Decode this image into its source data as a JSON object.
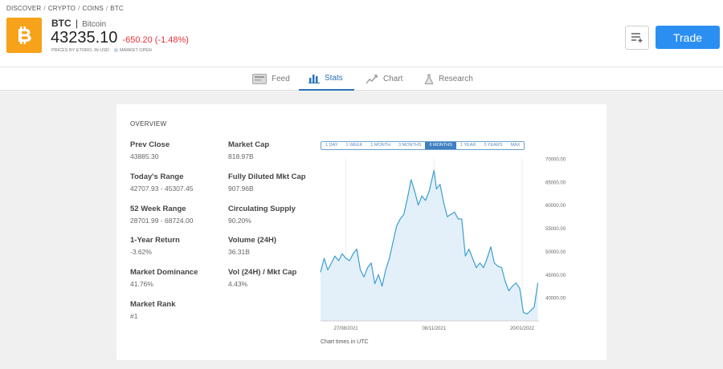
{
  "breadcrumb": [
    "DISCOVER",
    "CRYPTO",
    "COINS",
    "BTC"
  ],
  "asset": {
    "ticker": "BTC",
    "name": "Bitcoin",
    "price": "43235.10",
    "change": "-650.20 (-1.48%)",
    "price_source": "PRICES BY ETORO, IN USD",
    "market_status": "MARKET OPEN",
    "logo_icon": "bitcoin-logo-icon",
    "logo_color": "#f7a21a"
  },
  "actions": {
    "list_icon": "add-to-list-icon",
    "trade_label": "Trade",
    "trade_color": "#2b8ff2"
  },
  "tabs": [
    {
      "label": "Feed",
      "icon": "feed-icon"
    },
    {
      "label": "Stats",
      "icon": "stats-icon",
      "active": true
    },
    {
      "label": "Chart",
      "icon": "chart-icon"
    },
    {
      "label": "Research",
      "icon": "research-icon"
    }
  ],
  "overview": {
    "title": "OVERVIEW",
    "left": [
      {
        "label": "Prev Close",
        "value": "43885.30"
      },
      {
        "label": "Today's Range",
        "value": "42707.93 - 45307.45"
      },
      {
        "label": "52 Week Range",
        "value": "28701.99 - 68724.00"
      },
      {
        "label": "1-Year Return",
        "value": "-3.62%"
      },
      {
        "label": "Market Dominance",
        "value": "41.76%"
      },
      {
        "label": "Market Rank",
        "value": "#1"
      }
    ],
    "right": [
      {
        "label": "Market Cap",
        "value": "818.97B"
      },
      {
        "label": "Fully Diluted Mkt Cap",
        "value": "907.96B"
      },
      {
        "label": "Circulating Supply",
        "value": "90.20%"
      },
      {
        "label": "Volume (24H)",
        "value": "36.31B"
      },
      {
        "label": "Vol (24H) / Mkt Cap",
        "value": "4.43%"
      }
    ]
  },
  "range_tabs": [
    {
      "label": "1 DAY"
    },
    {
      "label": "1 WEEK"
    },
    {
      "label": "1 MONTH"
    },
    {
      "label": "3 MONTHS"
    },
    {
      "label": "6 MONTHS",
      "active": true
    },
    {
      "label": "1 YEAR"
    },
    {
      "label": "3 YEARS"
    },
    {
      "label": "MAX"
    }
  ],
  "chart_data": {
    "type": "area",
    "line_color": "#3a9fd1",
    "fill_color": "#e3f0fa",
    "ylim": [
      35000,
      70000
    ],
    "y_ticks": [
      "70000.00",
      "65000.00",
      "60000.00",
      "55000.00",
      "50000.00",
      "45000.00",
      "40000.00"
    ],
    "y_tick_values": [
      70000,
      65000,
      60000,
      55000,
      50000,
      45000,
      40000
    ],
    "x_ticks": [
      "27/08/2021",
      "08/11/2021",
      "20/01/2022"
    ],
    "x_tick_dates": [
      "2021-08-27",
      "2021-11-08",
      "2022-01-20"
    ],
    "x_range": [
      "2021-08-06",
      "2022-02-03"
    ],
    "series": [
      {
        "x": [
          "2021-08-06",
          "2021-08-09",
          "2021-08-12",
          "2021-08-15",
          "2021-08-18",
          "2021-08-21",
          "2021-08-24",
          "2021-08-27",
          "2021-08-30",
          "2021-09-02",
          "2021-09-05",
          "2021-09-08",
          "2021-09-11",
          "2021-09-14",
          "2021-09-17",
          "2021-09-20",
          "2021-09-23",
          "2021-09-26",
          "2021-09-29",
          "2021-10-02",
          "2021-10-05",
          "2021-10-08",
          "2021-10-11",
          "2021-10-14",
          "2021-10-17",
          "2021-10-20",
          "2021-10-23",
          "2021-10-26",
          "2021-10-29",
          "2021-11-01",
          "2021-11-04",
          "2021-11-08",
          "2021-11-10",
          "2021-11-13",
          "2021-11-16",
          "2021-11-19",
          "2021-11-22",
          "2021-11-25",
          "2021-11-28",
          "2021-12-01",
          "2021-12-04",
          "2021-12-07",
          "2021-12-10",
          "2021-12-13",
          "2021-12-16",
          "2021-12-19",
          "2021-12-22",
          "2021-12-25",
          "2021-12-28",
          "2021-12-31",
          "2022-01-03",
          "2022-01-06",
          "2022-01-09",
          "2022-01-12",
          "2022-01-15",
          "2022-01-18",
          "2022-01-21",
          "2022-01-24",
          "2022-01-27",
          "2022-01-30",
          "2022-02-02"
        ],
        "y": [
          45500,
          48500,
          46000,
          47500,
          49000,
          48000,
          49500,
          48500,
          48000,
          49500,
          50500,
          46000,
          44500,
          46500,
          47500,
          43000,
          45000,
          42500,
          46000,
          48500,
          52000,
          55500,
          57000,
          58000,
          61500,
          65500,
          63000,
          60000,
          62000,
          61000,
          63000,
          67500,
          63500,
          64500,
          60500,
          57500,
          58000,
          58500,
          57000,
          57000,
          49000,
          50500,
          48500,
          46500,
          47500,
          46500,
          48500,
          51000,
          47500,
          46800,
          46500,
          43500,
          41500,
          42500,
          43200,
          42000,
          36800,
          36500,
          37200,
          38000,
          43200
        ]
      }
    ]
  },
  "chart_note": "Chart times in UTC"
}
